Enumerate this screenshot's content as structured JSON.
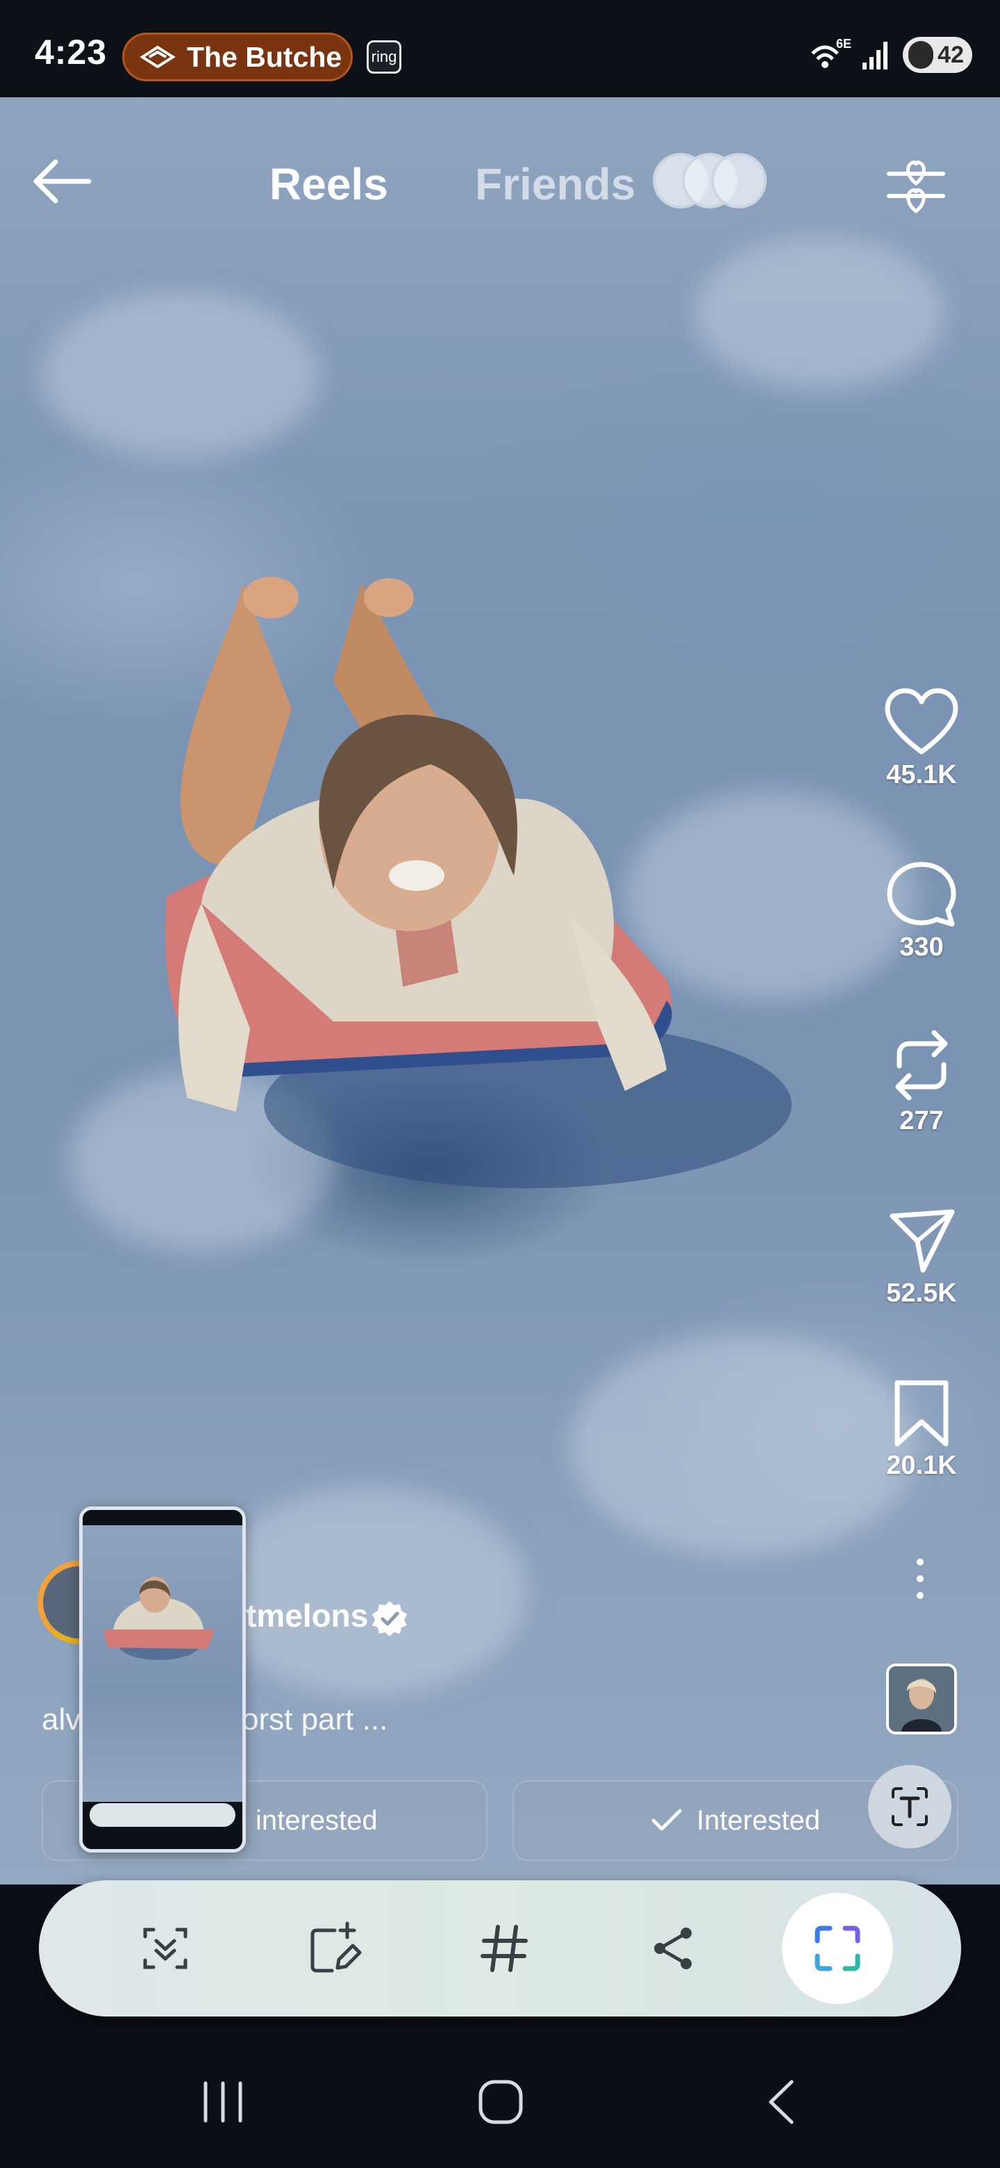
{
  "status_bar": {
    "time": "4:23",
    "live_activity": "The Butche",
    "notification_app": "ring",
    "network_label": "6E",
    "battery_level": "42"
  },
  "top_nav": {
    "tab_reels": "Reels",
    "tab_friends": "Friends"
  },
  "actions": {
    "like_count": "45.1K",
    "comment_count": "330",
    "repost_count": "277",
    "share_count": "52.5K",
    "save_count": "20.1K"
  },
  "post": {
    "author_visible": "tmelons",
    "caption_start": "alv",
    "caption_end": "orst part ...",
    "not_interested_label": "interested",
    "interested_label": "Interested"
  },
  "colors": {
    "accent_capture": "#3f7be6",
    "live_pill": "#7a3510",
    "toolbar_bg": "#dfe7ea"
  },
  "icons": {
    "toolbar": [
      "scroll-capture-icon",
      "draw-edit-icon",
      "hashtag-icon",
      "share-icon",
      "smart-select-icon"
    ],
    "system_nav": [
      "recents-icon",
      "home-icon",
      "back-icon"
    ]
  }
}
